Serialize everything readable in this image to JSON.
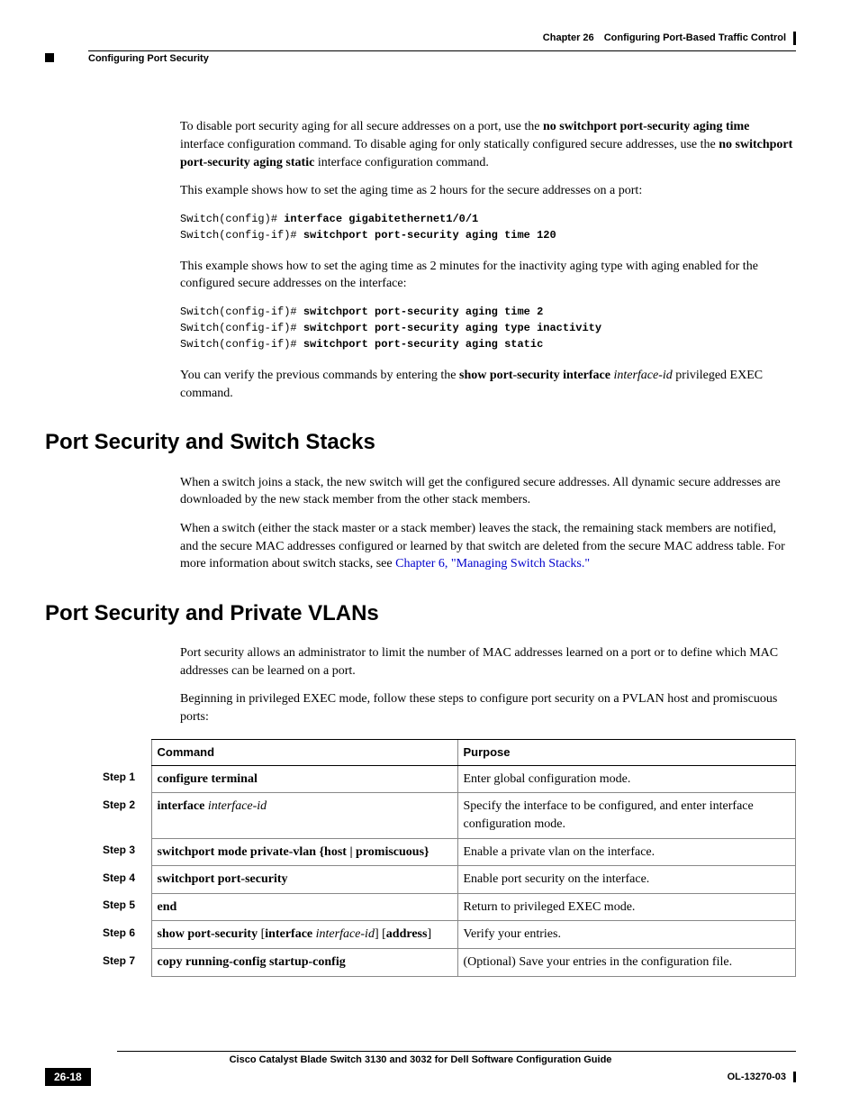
{
  "header": {
    "chapter": "Chapter 26",
    "chapter_title": "Configuring Port-Based Traffic Control",
    "section": "Configuring Port Security"
  },
  "body": {
    "p1_a": "To disable port security aging for all secure addresses on a port, use the ",
    "p1_b": "no switchport port-security aging time",
    "p1_c": " interface configuration command. To disable aging for only statically configured secure addresses, use the ",
    "p1_d": "no switchport port-security aging static",
    "p1_e": " interface configuration command.",
    "p2": "This example shows how to set the aging time as 2 hours for the secure addresses on a port:",
    "code1_l1a": "Switch(config)# ",
    "code1_l1b": "interface gigabitethernet1/0/1",
    "code1_l2a": "Switch(config-if)# ",
    "code1_l2b": "switchport port-security aging time 120",
    "p3": "This example shows how to set the aging time as 2 minutes for the inactivity aging type with aging enabled for the configured secure addresses on the interface:",
    "code2_l1a": "Switch(config-if)# ",
    "code2_l1b": "switchport port-security aging time 2",
    "code2_l2a": "Switch(config-if)# ",
    "code2_l2b": "switchport port-security aging type inactivity",
    "code2_l3a": "Switch(config-if)# ",
    "code2_l3b": "switchport port-security aging static",
    "p4_a": "You can verify the previous commands by entering the ",
    "p4_b": "show port-security interface ",
    "p4_c": "interface-id",
    "p4_d": " privileged EXEC command."
  },
  "h2_stacks": "Port Security and Switch Stacks",
  "stacks": {
    "p1": "When a switch joins a stack, the new switch will get the configured secure addresses. All dynamic secure addresses are downloaded by the new stack member from the other stack members.",
    "p2_a": "When a switch (either the stack master or a stack member) leaves the stack, the remaining stack members are notified, and the secure MAC addresses configured or learned by that switch are deleted from the secure MAC address table. For more information about switch stacks, see ",
    "p2_link": "Chapter 6, \"Managing Switch Stacks.\""
  },
  "h2_pvlan": "Port Security and Private VLANs",
  "pvlan": {
    "p1": "Port security allows an administrator to limit the number of MAC addresses learned on a port or to define which MAC addresses can be learned on a port.",
    "p2": "Beginning in privileged EXEC mode, follow these steps to configure port security on a PVLAN host and promiscuous ports:"
  },
  "table": {
    "h_cmd": "Command",
    "h_purpose": "Purpose",
    "r1_step": "Step 1",
    "r1_cmd": "configure terminal",
    "r1_purpose": "Enter global configuration mode.",
    "r2_step": "Step 2",
    "r2_cmd_a": "interface ",
    "r2_cmd_b": "interface-id",
    "r2_purpose": "Specify the interface to be configured, and enter interface configuration mode.",
    "r3_step": "Step 3",
    "r3_cmd": "switchport mode private-vlan {host | promiscuous}",
    "r3_purpose": " Enable a private vlan on the interface.",
    "r4_step": "Step 4",
    "r4_cmd": "switchport port-security",
    "r4_purpose": "Enable port security on the interface.",
    "r5_step": "Step 5",
    "r5_cmd": "end",
    "r5_purpose": "Return to privileged EXEC mode.",
    "r6_step": "Step 6",
    "r6_cmd_a": "show port-security ",
    "r6_cmd_b": "[",
    "r6_cmd_c": "interface ",
    "r6_cmd_d": "interface-id",
    "r6_cmd_e": "] [",
    "r6_cmd_f": "address",
    "r6_cmd_g": "]",
    "r6_purpose": "Verify your entries.",
    "r7_step": "Step 7",
    "r7_cmd": "copy running-config startup-config",
    "r7_purpose": "(Optional) Save your entries in the configuration file."
  },
  "footer": {
    "title": "Cisco Catalyst Blade Switch 3130 and 3032 for Dell Software Configuration Guide",
    "page": "26-18",
    "doc": "OL-13270-03"
  }
}
